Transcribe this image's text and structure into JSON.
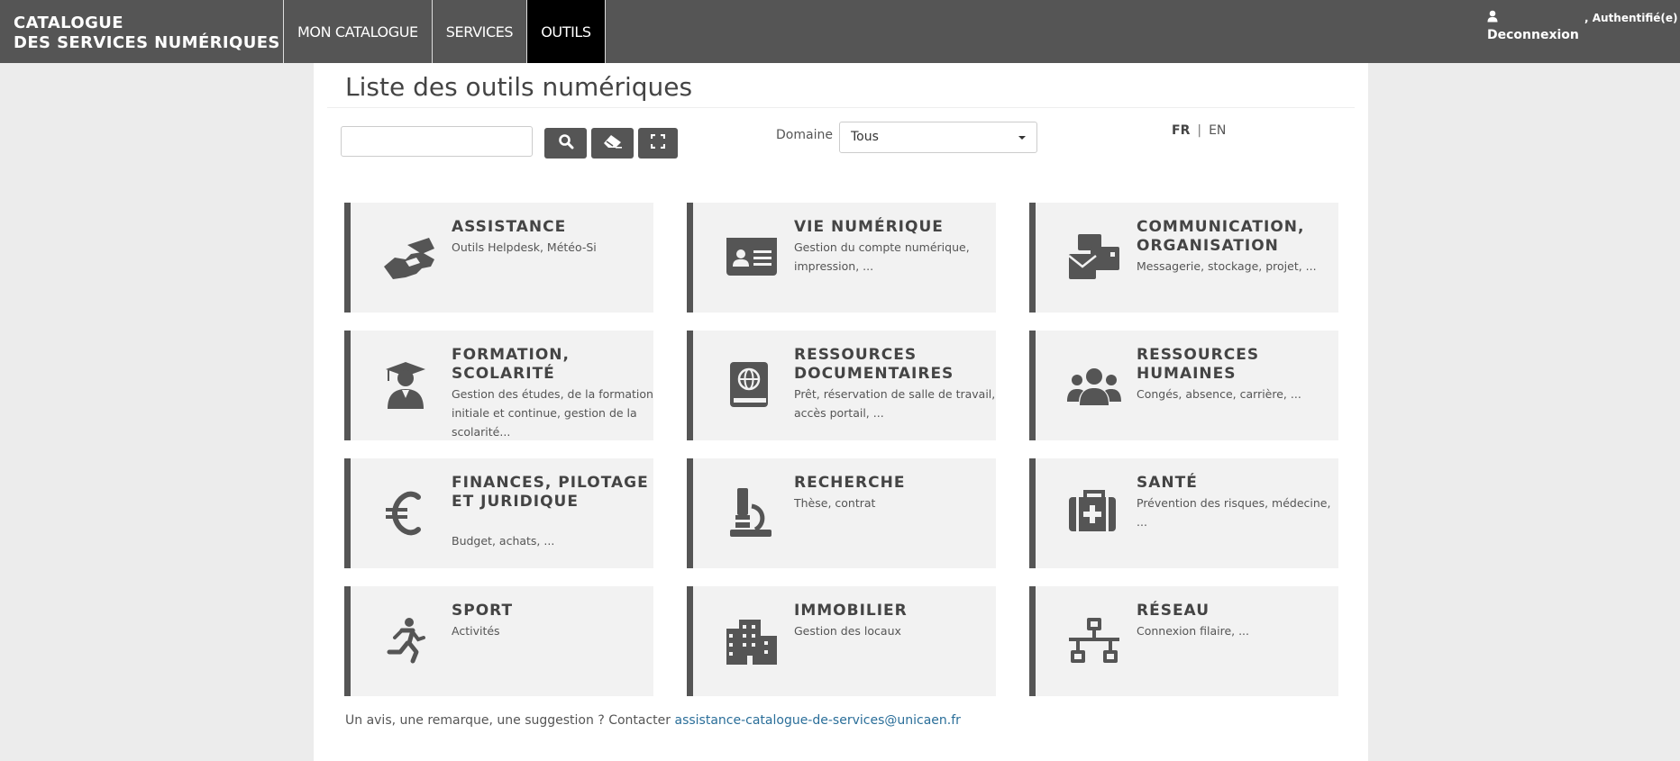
{
  "navbar": {
    "brand_line1": "CATALOGUE",
    "brand_line2": "DES SERVICES NUMÉRIQUES",
    "items": [
      {
        "label": "MON CATALOGUE",
        "active": false
      },
      {
        "label": "SERVICES",
        "active": false
      },
      {
        "label": "OUTILS",
        "active": true
      }
    ],
    "logout_label": "Deconnexion",
    "auth_label": ", Authentifié(e)"
  },
  "page": {
    "title": "Liste des outils numériques"
  },
  "search": {
    "value": "",
    "placeholder": ""
  },
  "filters": {
    "domain_label": "Domaine",
    "domain_selected": "Tous"
  },
  "language": {
    "fr": "FR",
    "separator": "|",
    "en": "EN"
  },
  "cards": [
    {
      "title": "ASSISTANCE",
      "desc": "Outils Helpdesk, Météo-Si",
      "icon": "handshake-icon"
    },
    {
      "title": "VIE NUMÉRIQUE",
      "desc": "Gestion du compte numérique, impression, ...",
      "icon": "id-card-icon"
    },
    {
      "title": "COMMUNICATION, ORGANISATION",
      "desc": "Messagerie, stockage, projet, ...",
      "icon": "envelopes-icon"
    },
    {
      "title": "FORMATION, SCOLARITÉ",
      "desc": "Gestion des études, de la formation initiale et continue, gestion de la scolarité...",
      "icon": "graduate-icon"
    },
    {
      "title": "RESSOURCES DOCUMENTAIRES",
      "desc": "Prêt, réservation de salle de travail, accès portail, ...",
      "icon": "atlas-icon"
    },
    {
      "title": "RESSOURCES HUMAINES",
      "desc": "Congés, absence, carrière, ...",
      "icon": "users-icon"
    },
    {
      "title": "FINANCES, PILOTAGE ET JURIDIQUE",
      "desc": "Budget, achats, ...",
      "icon": "euro-icon"
    },
    {
      "title": "RECHERCHE",
      "desc": "Thèse, contrat",
      "icon": "microscope-icon"
    },
    {
      "title": "SANTÉ",
      "desc": "Prévention des risques, médecine, ...",
      "icon": "medkit-icon"
    },
    {
      "title": "SPORT",
      "desc": "Activités",
      "icon": "running-icon"
    },
    {
      "title": "IMMOBILIER",
      "desc": "Gestion des locaux",
      "icon": "building-icon"
    },
    {
      "title": "RÉSEAU",
      "desc": "Connexion filaire, ...",
      "icon": "network-icon"
    }
  ],
  "footer": {
    "text": "Un avis, une remarque, une suggestion ? Contacter ",
    "link": "assistance-catalogue-de-services@unicaen.fr"
  },
  "colors": {
    "navbar_bg": "#555555",
    "active_tab_bg": "#000000",
    "card_bg": "#f2f2f2",
    "card_accent": "#555555",
    "link": "#2a6e99"
  }
}
